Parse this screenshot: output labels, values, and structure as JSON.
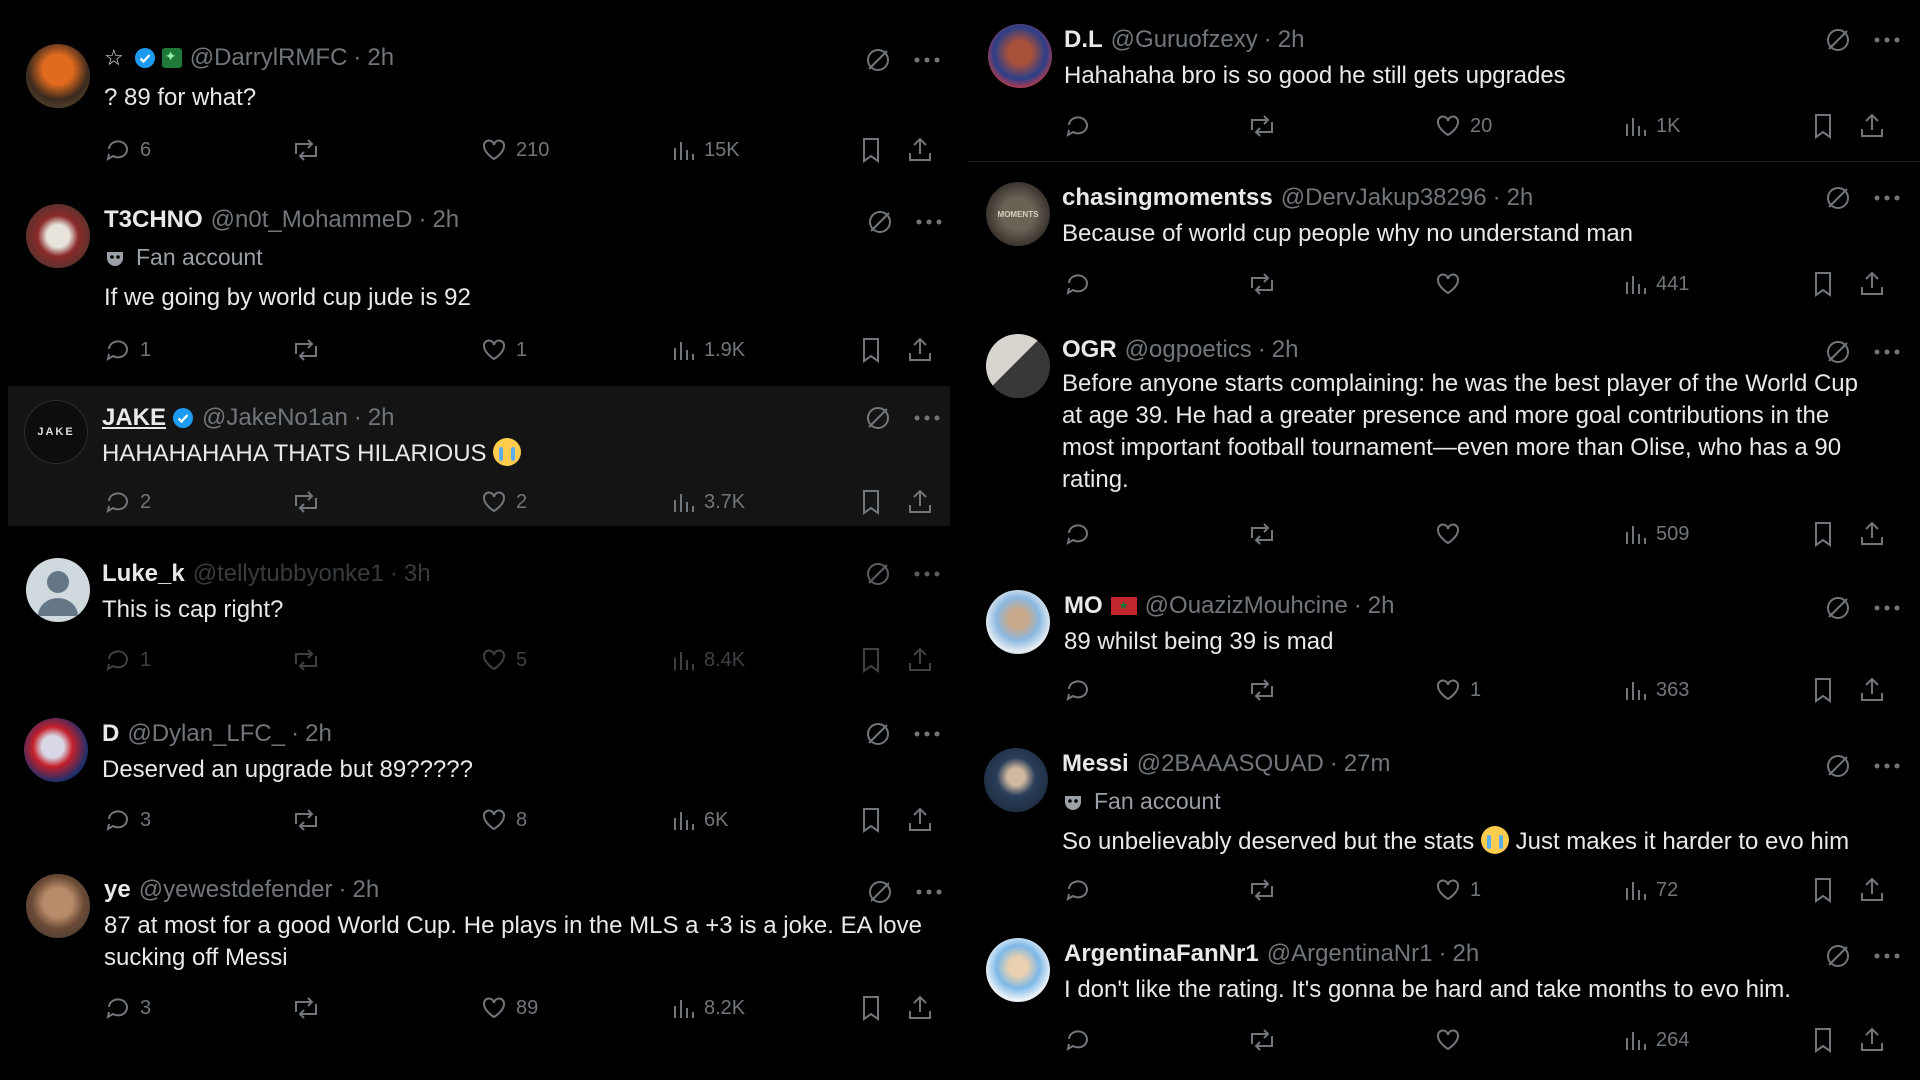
{
  "left_column": [
    {
      "prefix_star": "☆",
      "name": "",
      "handle": "@DarrylRMFC",
      "time": "2h",
      "text": "? 89 for what?",
      "replies": "6",
      "reposts": "",
      "likes": "210",
      "views": "15K"
    },
    {
      "name": "T3CHNO",
      "handle": "@n0t_MohammeD",
      "time": "2h",
      "fan_label": "Fan account",
      "text": "If we going by world cup jude is 92",
      "replies": "1",
      "reposts": "",
      "likes": "1",
      "views": "1.9K"
    },
    {
      "name": "JAKE",
      "avatar_text": "JAKE",
      "handle": "@JakeNo1an",
      "time": "2h",
      "text": "HAHAHAHAHA THATS HILARIOUS",
      "replies": "2",
      "reposts": "",
      "likes": "2",
      "views": "3.7K"
    },
    {
      "name": "Luke_k",
      "handle": "@tellytubbyonke1",
      "time": "3h",
      "text": "This is cap right?",
      "replies": "1",
      "reposts": "",
      "likes": "5",
      "views": "8.4K"
    },
    {
      "name": "D",
      "handle": "@Dylan_LFC_",
      "time": "2h",
      "text": "Deserved an upgrade but 89?????",
      "replies": "3",
      "reposts": "",
      "likes": "8",
      "views": "6K"
    },
    {
      "name": "ye",
      "handle": "@yewestdefender",
      "time": "2h",
      "text_line1": "87 at most for a good World Cup. He plays in the MLS a +3 is a joke. EA love",
      "text_line2": "sucking off Messi",
      "replies": "3",
      "reposts": "",
      "likes": "89",
      "views": "8.2K"
    }
  ],
  "right_column": [
    {
      "name": "D.L",
      "handle": "@Guruofzexy",
      "time": "2h",
      "text": "Hahahaha bro is so good he still gets upgrades",
      "replies": "",
      "reposts": "",
      "likes": "20",
      "views": "1K"
    },
    {
      "name": "chasingmomentss",
      "avatar_text": "MOMENTS",
      "handle": "@DervJakup38296",
      "time": "2h",
      "text": "Because of world cup people why no understand man",
      "replies": "",
      "reposts": "",
      "likes": "",
      "views": "441"
    },
    {
      "name": "OGR",
      "handle": "@ogpoetics",
      "time": "2h",
      "text_line1": "Before anyone starts complaining: he was the best player of the World Cup",
      "text_line2": "at age 39. He had a greater presence and more goal contributions in the",
      "text_line3": "most important football tournament—even more than Olise, who has a 90",
      "text_line4": "rating.",
      "replies": "",
      "reposts": "",
      "likes": "",
      "views": "509"
    },
    {
      "name": "MO",
      "handle": "@OuazizMouhcine",
      "time": "2h",
      "text": "89 whilst being 39 is mad",
      "replies": "",
      "reposts": "",
      "likes": "1",
      "views": "363"
    },
    {
      "name": "Messi",
      "handle": "@2BAAASQUAD",
      "time": "27m",
      "fan_label": "Fan account",
      "text_a": "So unbelievably deserved but the stats",
      "text_b": "Just makes it harder to evo him",
      "replies": "",
      "reposts": "",
      "likes": "1",
      "views": "72"
    },
    {
      "name": "ArgentinaFanNr1",
      "handle": "@ArgentinaNr1",
      "time": "2h",
      "text": "I don't like the rating. It's gonna be hard and take months to evo him.",
      "replies": "",
      "reposts": "",
      "likes": "",
      "views": "264"
    }
  ],
  "separator_dot": "·",
  "colors": {
    "background": "#000000",
    "text": "#e7e9ea",
    "muted": "#71767b",
    "verified": "#1d9bf0"
  }
}
